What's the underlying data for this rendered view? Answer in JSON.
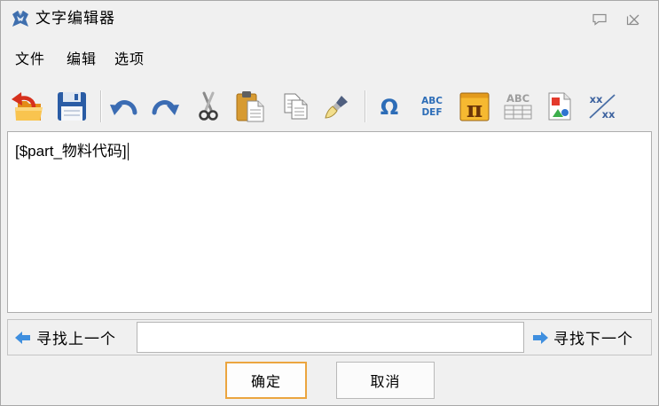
{
  "window": {
    "title": "文字编辑器",
    "app_icon": "app-logo-icon",
    "title_bar_icons": [
      "speech-bubble-icon",
      "close-icon"
    ]
  },
  "menu": {
    "items": [
      {
        "label": "文件"
      },
      {
        "label": "编辑"
      },
      {
        "label": "选项"
      }
    ]
  },
  "toolbar": {
    "tools": [
      {
        "icon": "open-icon"
      },
      {
        "icon": "save-icon"
      },
      {
        "icon": "undo-icon"
      },
      {
        "icon": "redo-icon"
      },
      {
        "icon": "cut-icon"
      },
      {
        "icon": "paste-icon"
      },
      {
        "icon": "copy-icon"
      },
      {
        "icon": "format-brush-icon"
      },
      {
        "icon": "special-character-icon",
        "glyph": "Ω"
      },
      {
        "icon": "change-case-icon",
        "glyph_top": "ABC",
        "glyph_bottom": "DEF"
      },
      {
        "icon": "math-symbol-icon",
        "glyph": "π"
      },
      {
        "icon": "text-table-icon",
        "glyph": "ABC"
      },
      {
        "icon": "insert-image-icon"
      },
      {
        "icon": "fraction-icon",
        "glyph_top": "xx",
        "glyph_bottom": "xx"
      }
    ]
  },
  "editor": {
    "content": "[$part_物料代码]",
    "cursor_visible": true
  },
  "search": {
    "prev_icon": "arrow-left-icon",
    "prev_label": "寻找上一个",
    "query": "",
    "next_icon": "arrow-right-icon",
    "next_label": "寻找下一个"
  },
  "actions": {
    "ok_label": "确定",
    "ok_is_default": true,
    "cancel_label": "取消"
  },
  "colors": {
    "window_bg": "#f0f0f0",
    "editor_bg": "#ffffff",
    "icon_blue": "#2d6db7",
    "search_arrow": "#3f8fdf",
    "default_button_border": "#eba53f"
  }
}
